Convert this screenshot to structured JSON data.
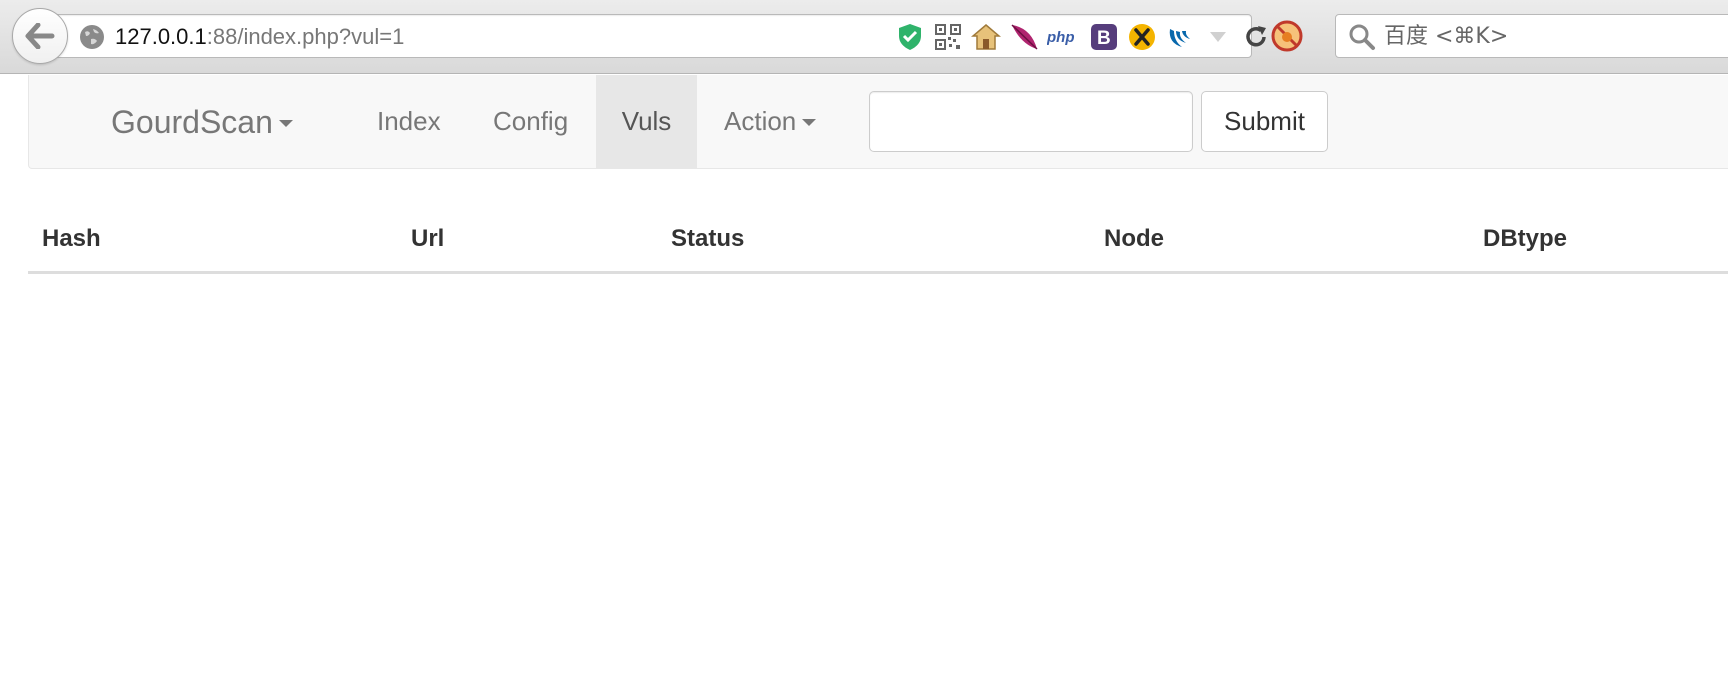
{
  "browser": {
    "url_host": "127.0.0.1",
    "url_rest": ":88/index.php?vul=1",
    "search_placeholder": "百度 <⌘K>",
    "extension_icons": [
      "shield-check-icon",
      "qr-code-icon",
      "home-icon",
      "feather-icon",
      "php-icon",
      "bootstrap-icon",
      "x-icon",
      "jquery-icon",
      "dropdown-triangle-icon",
      "reload-icon"
    ]
  },
  "navbar": {
    "brand": "GourdScan",
    "items": [
      {
        "label": "Index"
      },
      {
        "label": "Config"
      },
      {
        "label": "Vuls",
        "active": true
      },
      {
        "label": "Action",
        "dropdown": true
      }
    ],
    "search_value": "",
    "submit_label": "Submit"
  },
  "table": {
    "columns": [
      "Hash",
      "Url",
      "Status",
      "Node",
      "DBtype"
    ],
    "rows": []
  },
  "colors": {
    "navbar_bg": "#f8f8f8",
    "active_tab_bg": "#e7e7e7",
    "nav_text": "#777777",
    "header_text": "#333333"
  }
}
